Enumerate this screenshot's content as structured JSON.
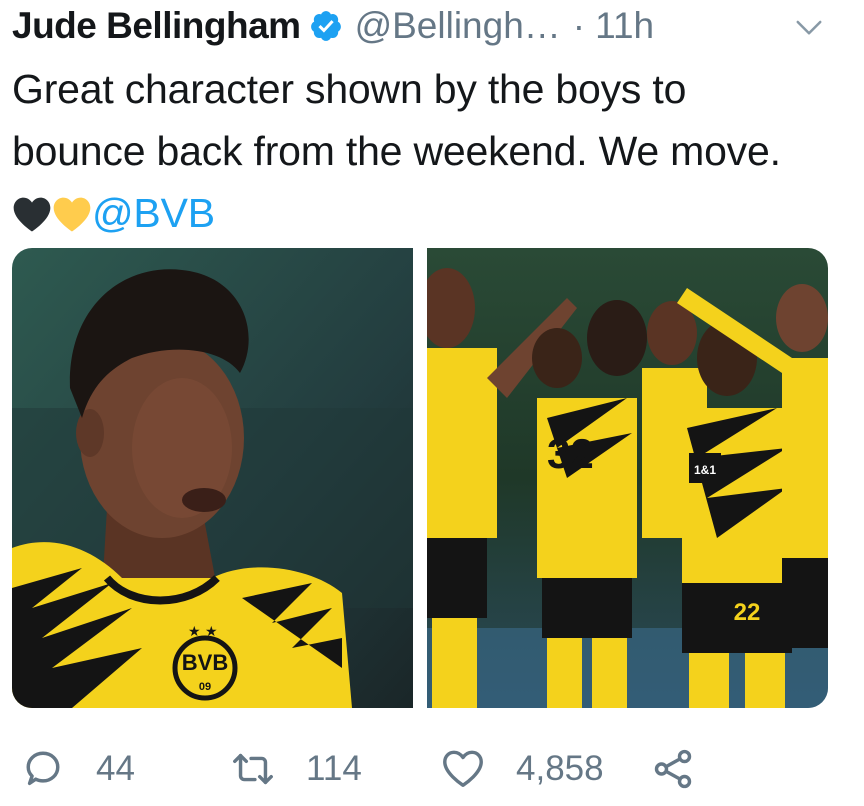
{
  "tweet": {
    "author_name": "Jude Bellingham",
    "handle": "@Bellingh…",
    "separator": "·",
    "time": "11h",
    "text_main": "Great character shown by the boys to bounce back from the weekend. We move.",
    "mention": "@BVB",
    "emojis": [
      "black-heart",
      "yellow-heart"
    ],
    "media": {
      "left_photo_badge": "BVB",
      "left_photo_badge_year": "09",
      "right_photo_sponsor": "1&1",
      "right_photo_number": "22"
    },
    "counts": {
      "replies": "44",
      "retweets": "114",
      "likes": "4,858"
    }
  },
  "colors": {
    "text": "#14171a",
    "secondary": "#657786",
    "link": "#1da1f2",
    "bvb_yellow": "#f4d21c"
  }
}
